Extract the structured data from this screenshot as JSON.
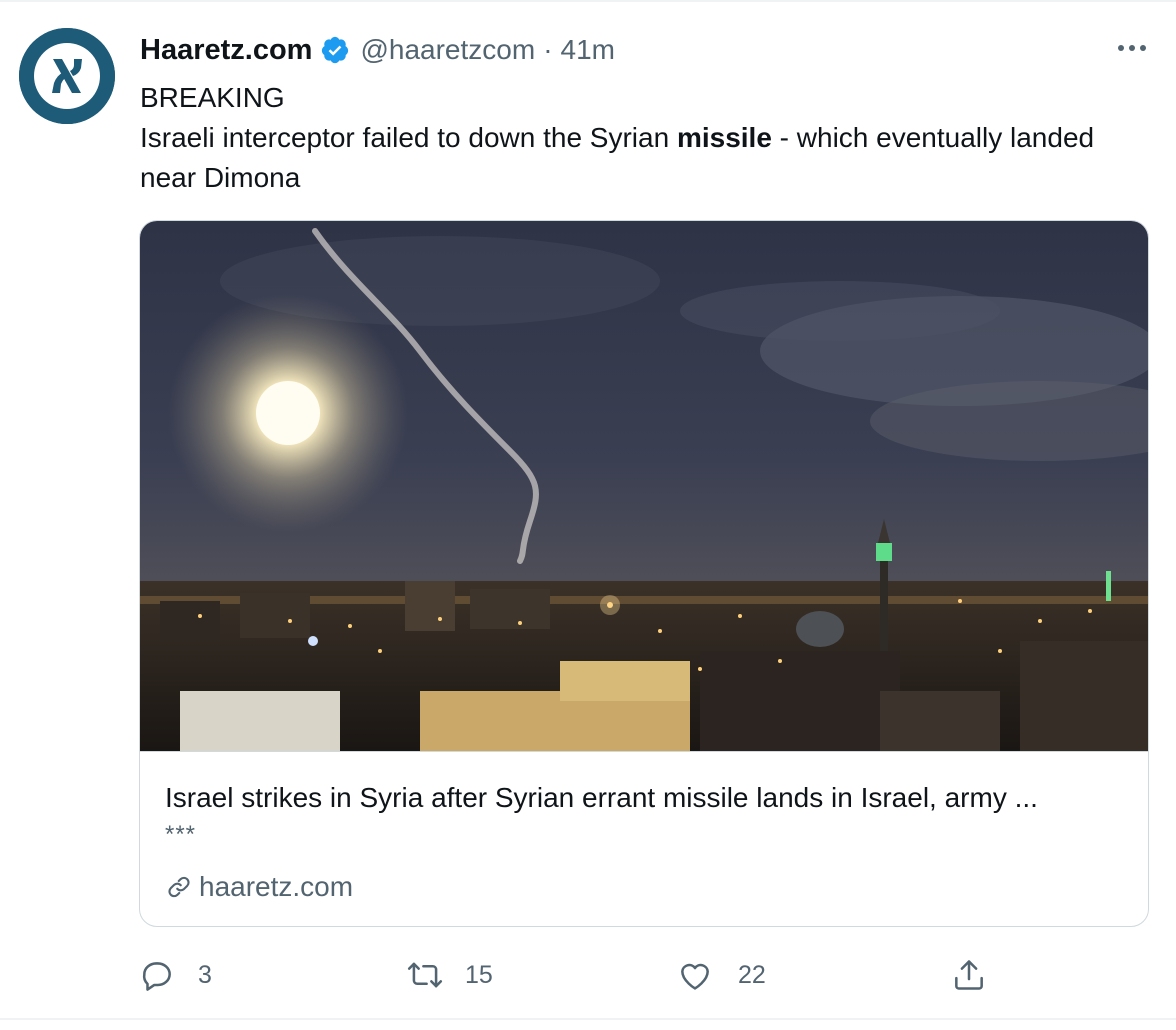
{
  "tweet": {
    "author_name": "Haaretz.com",
    "handle": "@haaretzcom",
    "separator": "·",
    "time": "41m",
    "text_line1": "BREAKING",
    "text_before_bold": "Israeli interceptor failed to down the Syrian ",
    "text_bold": "missile",
    "text_after_bold": " - which eventually landed near Dimona"
  },
  "card": {
    "title": "Israel strikes in Syria after Syrian errant missile lands in Israel, army ...",
    "description": "***",
    "domain": "haaretz.com"
  },
  "actions": {
    "reply_count": "3",
    "retweet_count": "15",
    "like_count": "22"
  },
  "icons": {
    "avatar": "haaretz-logo-icon",
    "verified": "verified-badge-icon",
    "more": "more-options-icon",
    "link": "link-icon",
    "reply": "reply-icon",
    "retweet": "retweet-icon",
    "like": "like-icon",
    "share": "share-icon"
  },
  "colors": {
    "text": "#0f1419",
    "secondary": "#536471",
    "verified": "#1d9bf0",
    "avatar_bg": "#1d5b79",
    "border": "#cfd9de"
  }
}
